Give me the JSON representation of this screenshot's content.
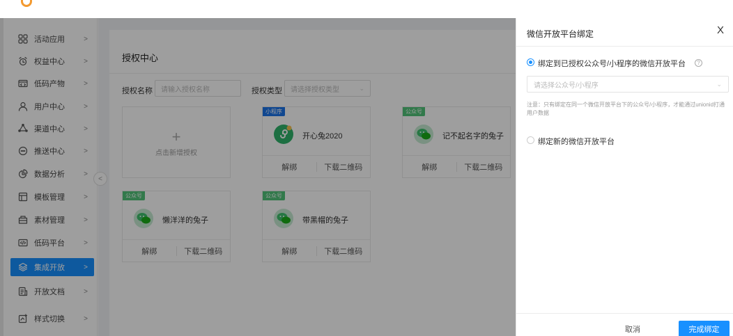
{
  "brand": {
    "logo_text": "",
    "accent": "#1890ff"
  },
  "sidebar": {
    "items": [
      {
        "label": "活动应用",
        "icon": "grid-apps-icon",
        "active": false
      },
      {
        "label": "权益中心",
        "icon": "alarm-clock-icon",
        "active": false
      },
      {
        "label": "低码产物",
        "icon": "code-box-icon",
        "active": false
      },
      {
        "label": "用户中心",
        "icon": "user-icon",
        "active": false
      },
      {
        "label": "渠道中心",
        "icon": "channel-hub-icon",
        "active": false
      },
      {
        "label": "推送中心",
        "icon": "message-circle-icon",
        "active": false
      },
      {
        "label": "数据分析",
        "icon": "pie-chart-icon",
        "active": false
      },
      {
        "label": "模板管理",
        "icon": "template-icon",
        "active": false
      },
      {
        "label": "素材管理",
        "icon": "folder-icon",
        "active": false
      },
      {
        "label": "低码平台",
        "icon": "code-platform-icon",
        "active": false
      },
      {
        "label": "集成开放",
        "icon": "layers-icon",
        "active": true
      },
      {
        "label": "开放文档",
        "icon": "document-icon",
        "active": false
      },
      {
        "label": "样式切换",
        "icon": "style-switch-icon",
        "active": false
      }
    ],
    "chevron": ">",
    "collapse": "<"
  },
  "main": {
    "title": "授权中心",
    "filters": {
      "name_label": "授权名称",
      "name_placeholder": "请输入授权名称",
      "type_label": "授权类型",
      "type_placeholder": "请选择授权类型"
    },
    "add_card": {
      "plus": "+",
      "label": "点击新增授权"
    },
    "cards": [
      {
        "tag": "小程序",
        "tag_type": "mini",
        "name": "开心兔2020",
        "unbind": "解绑",
        "download": "下载二维码"
      },
      {
        "tag": "公众号",
        "tag_type": "gzh",
        "name": "记不起名字的兔子",
        "unbind": "解绑",
        "download": "下载二维码"
      },
      {
        "tag": "公众号",
        "tag_type": "gzh",
        "name": "懒洋洋的兔子",
        "unbind": "解绑",
        "download": "下载二维码"
      },
      {
        "tag": "公众号",
        "tag_type": "gzh",
        "name": "带黑帽的兔子",
        "unbind": "解绑",
        "download": "下载二维码"
      }
    ]
  },
  "drawer": {
    "title": "微信开放平台绑定",
    "close": "X",
    "option1": "绑定到已授权公众号/小程序的微信开放平台",
    "help": "?",
    "select_placeholder": "请选择公众号/小程序",
    "note": "注意：只有绑定在同一个微信开放平台下的公众号/小程序，才能通过unionid打通用户数据",
    "option2": "绑定新的微信开放平台",
    "cancel": "取消",
    "confirm": "完成绑定"
  }
}
